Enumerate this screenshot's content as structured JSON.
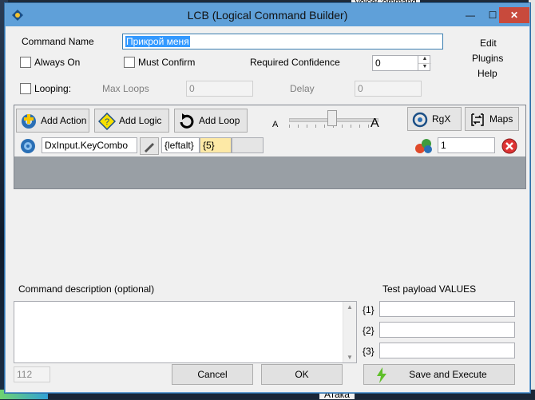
{
  "background": {
    "top_text": "VoiceCommand",
    "tree_text": "Атака"
  },
  "window": {
    "title": "LCB (Logical Command Builder)",
    "minimize_glyph": "—",
    "maximize_glyph": "☐",
    "close_glyph": "✕"
  },
  "form": {
    "command_name_label": "Command Name",
    "command_name_value": "Прикрой меня",
    "always_on_label": "Always On",
    "must_confirm_label": "Must Confirm",
    "required_confidence_label": "Required Confidence",
    "required_confidence_value": "0",
    "looping_label": "Looping:",
    "max_loops_label": "Max Loops",
    "max_loops_value": "0",
    "delay_label": "Delay",
    "delay_value": "0"
  },
  "menu": {
    "edit": "Edit",
    "plugins": "Plugins",
    "help": "Help"
  },
  "toolbar": {
    "add_action": "Add Action",
    "add_logic": "Add Logic",
    "add_loop": "Add Loop",
    "size_small": "A",
    "size_large": "A",
    "rgx": "RgX",
    "maps": "Maps"
  },
  "action_row": {
    "action_type": "DxInput.KeyCombo",
    "param1": "{leftalt}",
    "param2": "{5}",
    "param3": "",
    "count": "1"
  },
  "description": {
    "label": "Command description (optional)",
    "value": "",
    "char_count": "112"
  },
  "payload": {
    "label": "Test payload VALUES",
    "rows": [
      {
        "key": "{1}",
        "value": ""
      },
      {
        "key": "{2}",
        "value": ""
      },
      {
        "key": "{3}",
        "value": ""
      }
    ]
  },
  "buttons": {
    "cancel": "Cancel",
    "ok": "OK",
    "save_execute": "Save and Execute"
  },
  "colors": {
    "titlebar": "#5fa0d9",
    "panel_gray": "#999fa5",
    "param_highlight": "#fde9a6",
    "close_red": "#c84a3c"
  }
}
